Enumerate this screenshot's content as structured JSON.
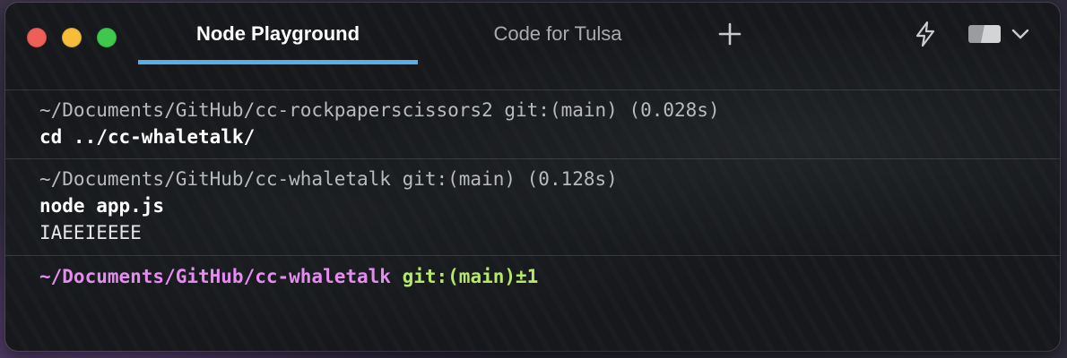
{
  "tabs": [
    {
      "label": "Node Playground",
      "active": true
    },
    {
      "label": "Code for Tulsa",
      "active": false
    }
  ],
  "icons": {
    "new_tab": "plus-icon",
    "ai": "lightning-bolt-icon",
    "panes": "split-pane-icon",
    "dropdown": "chevron-down-icon"
  },
  "colors": {
    "tab_indicator": "#5aaee8",
    "prompt_path": "#e58cf0",
    "prompt_git": "#b6e86a",
    "traffic_close": "#ee5f58",
    "traffic_minimize": "#f6bd3b",
    "traffic_maximize": "#3fc84d"
  },
  "blocks": [
    {
      "header": "~/Documents/GitHub/cc-rockpaperscissors2 git:(main) (0.028s)",
      "command": "cd ../cc-whaletalk/",
      "output": ""
    },
    {
      "header": "~/Documents/GitHub/cc-whaletalk git:(main) (0.128s)",
      "command": "node app.js",
      "output": "IAEEIEEEE"
    }
  ],
  "prompt": {
    "path": "~/Documents/GitHub/cc-whaletalk",
    "git": "git:(main)±1"
  }
}
